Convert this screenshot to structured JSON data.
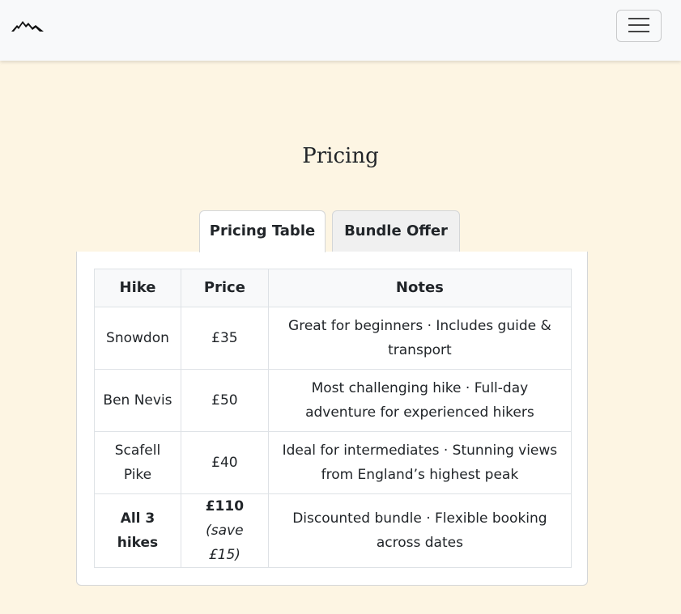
{
  "navbar": {
    "logo_icon": "mountain-logo-icon",
    "menu_icon": "hamburger-menu-icon",
    "background": "#f8f9fa"
  },
  "page": {
    "title": "Pricing",
    "background": "#fdf5e3"
  },
  "tabs": [
    {
      "label": "Pricing Table",
      "active": true
    },
    {
      "label": "Bundle Offer",
      "active": false
    }
  ],
  "table": {
    "headers": [
      "Hike",
      "Price",
      "Notes"
    ],
    "rows": [
      {
        "hike": "Snowdon",
        "price": "£35",
        "notes": "Great for beginners · Includes guide & transport"
      },
      {
        "hike": "Ben Nevis",
        "price": "£50",
        "notes": "Most challenging hike · Full-day adventure for experienced hikers"
      },
      {
        "hike": "Scafell Pike",
        "price": "£40",
        "notes": "Ideal for intermediates · Stunning views from England’s highest peak"
      },
      {
        "hike": "All 3 hikes",
        "price": "£110",
        "price_note": "(save £15)",
        "notes": "Discounted bundle · Flexible booking across dates"
      }
    ]
  }
}
